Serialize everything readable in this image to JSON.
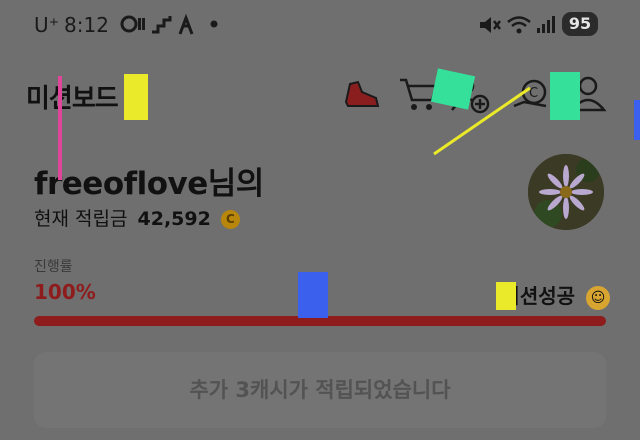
{
  "status_bar": {
    "carrier": "U⁺",
    "time": "8:12",
    "battery": "95",
    "icons": [
      "pause-media-icon",
      "stairs-icon",
      "figure-icon",
      "dot-icon",
      "mute-icon",
      "wifi-icon",
      "signal-icon",
      "battery-icon"
    ]
  },
  "header": {
    "title": "미션보드",
    "icons": [
      "shoe-icon",
      "cart-icon",
      "add-friend-icon",
      "coin-hand-icon",
      "profile-icon"
    ]
  },
  "user": {
    "greeting": "freeoflove님의",
    "points_label": "현재 적립금",
    "points_value": "42,592",
    "coin_symbol": "C"
  },
  "progress": {
    "label": "진행률",
    "percent_text": "100%",
    "value": 1.0,
    "status": "미션성공",
    "color": "#8e1c1c"
  },
  "result": {
    "label": "추가 3캐시가 적립되었습니다"
  }
}
